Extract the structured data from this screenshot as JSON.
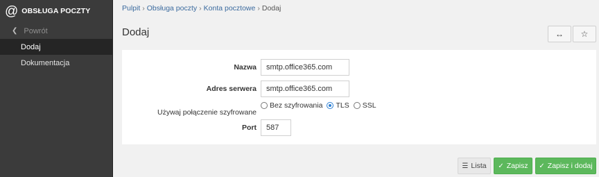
{
  "sidebar": {
    "logo_icon": "@",
    "title": "OBSŁUGA POCZTY",
    "back_label": "Powrót",
    "items": [
      {
        "label": "Dodaj",
        "active": true
      },
      {
        "label": "Dokumentacja",
        "active": false
      }
    ]
  },
  "breadcrumb": {
    "items": [
      "Pulpit",
      "Obsługa poczty",
      "Konta pocztowe"
    ],
    "current": "Dodaj",
    "separator": "›"
  },
  "page": {
    "title": "Dodaj",
    "expand_icon": "↔",
    "star_icon": "☆"
  },
  "form": {
    "name_label": "Nazwa",
    "name_value": "smtp.office365.com",
    "server_label": "Adres serwera",
    "server_value": "smtp.office365.com",
    "encryption_label": "Używaj połączenie szyfrowane",
    "encryption_options": [
      "Bez szyfrowania",
      "TLS",
      "SSL"
    ],
    "encryption_selected": "TLS",
    "port_label": "Port",
    "port_value": "587"
  },
  "footer": {
    "list_label": "Lista",
    "save_label": "Zapisz",
    "save_add_label": "Zapisz i dodaj"
  },
  "colors": {
    "sidebar_bg": "#3b3b3b",
    "sidebar_active": "#252525",
    "success": "#5cb85c",
    "link": "#3a6a9e",
    "radio_accent": "#2d7fd3"
  }
}
